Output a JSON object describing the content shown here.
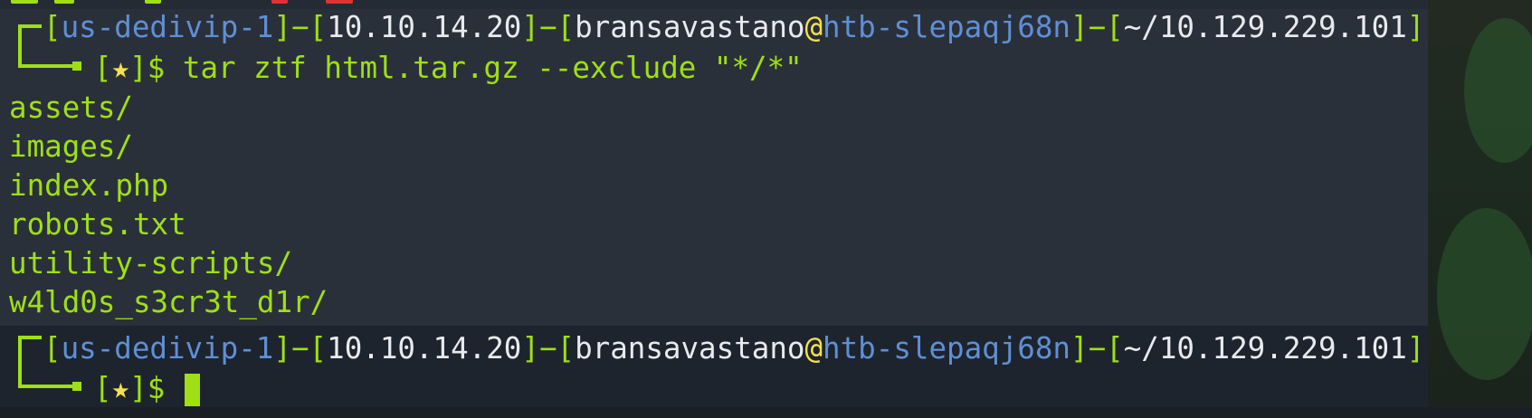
{
  "colors": {
    "terminal_bg": "#2a303a",
    "prompt_green": "#9ee015",
    "host_blue": "#5f8fd6",
    "text_white": "#e8eaee",
    "star_yellow": "#f3e24b"
  },
  "prompt1": {
    "open1": "[",
    "vpn": "us-dedivip-1",
    "close1": "]",
    "dash1": "−",
    "open2": "[",
    "ip": "10.10.14.20",
    "close2": "]",
    "dash2": "−",
    "open3": "[",
    "user": "bransavastano",
    "at": "@",
    "host": "htb-slepaqj68n",
    "close3": "]",
    "dash3": "−",
    "open4": "[",
    "path": "~/10.129.229.101",
    "close4": "]",
    "status_open": "[",
    "status_star": "★",
    "status_close": "]",
    "dollar": "$",
    "command": "tar ztf html.tar.gz --exclude \"*/*\""
  },
  "output": [
    "assets/",
    "images/",
    "index.php",
    "robots.txt",
    "utility-scripts/",
    "w4ld0s_s3cr3t_d1r/"
  ],
  "prompt2": {
    "open1": "[",
    "vpn": "us-dedivip-1",
    "close1": "]",
    "dash1": "−",
    "open2": "[",
    "ip": "10.10.14.20",
    "close2": "]",
    "dash2": "−",
    "open3": "[",
    "user": "bransavastano",
    "at": "@",
    "host": "htb-slepaqj68n",
    "close3": "]",
    "dash3": "−",
    "open4": "[",
    "path": "~/10.129.229.101",
    "close4": "]",
    "status_open": "[",
    "status_star": "★",
    "status_close": "]",
    "dollar": "$",
    "command": ""
  }
}
